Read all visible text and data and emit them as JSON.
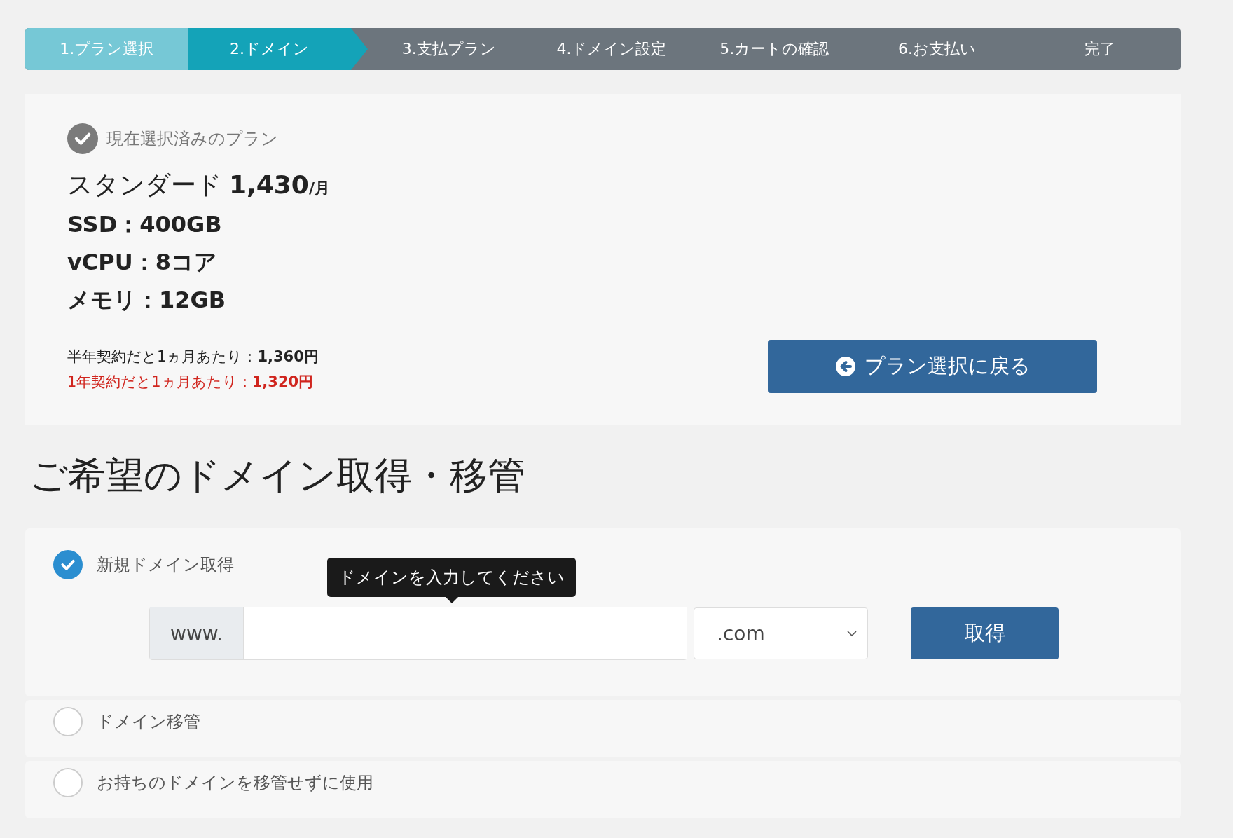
{
  "steps": [
    {
      "label": "1.プラン選択",
      "completed": true,
      "selected": false
    },
    {
      "label": "2.ドメイン",
      "completed": false,
      "selected": true
    },
    {
      "label": "3.支払プラン",
      "completed": false,
      "selected": false
    },
    {
      "label": "4.ドメイン設定",
      "completed": false,
      "selected": false
    },
    {
      "label": "5.カートの確認",
      "completed": false,
      "selected": false
    },
    {
      "label": "6.お支払い",
      "completed": false,
      "selected": false
    },
    {
      "label": "完了",
      "completed": false,
      "selected": false
    }
  ],
  "plan": {
    "caption": "現在選択済みのプラン",
    "name": "スタンダード",
    "price": "1,430",
    "unit": "/月",
    "specs": [
      "SSD：400GB",
      "vCPU：8コア",
      "メモリ：12GB"
    ],
    "offers": [
      {
        "text": "半年契約だと1ヵ月あたり：**1,360円**",
        "color": "#222222"
      },
      {
        "text": "1年契約だと1ヵ月あたり：**1,320円**",
        "color": "#d0251e"
      }
    ],
    "back_button": "プラン選択に戻る"
  },
  "heading": "ご希望のドメイン取得・移管",
  "options": [
    {
      "label": "新規ドメイン取得",
      "selected": true,
      "form": {
        "prefix": "www.",
        "tooltip": "ドメインを入力してください",
        "tld": ".com",
        "button": "取得"
      }
    },
    {
      "label": "ドメイン移管",
      "selected": false
    },
    {
      "label": "お持ちのドメインを移管せずに使用",
      "selected": false
    }
  ]
}
